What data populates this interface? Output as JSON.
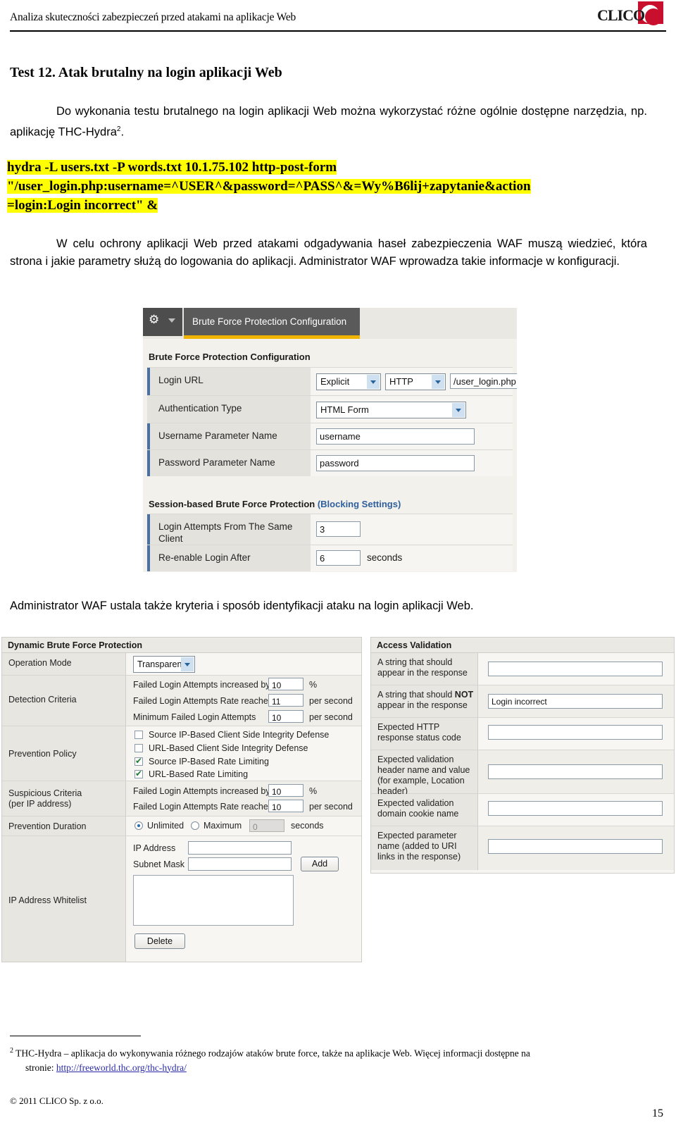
{
  "header": {
    "title": "Analiza skuteczności zabezpieczeń przed atakami na aplikacje Web",
    "logo_text": "CLICO",
    "logo_accent": "#c8102e"
  },
  "doc": {
    "title": "Test 12. Atak brutalny na login aplikacji Web",
    "intro": "Do wykonania testu brutalnego na login aplikacji Web można wykorzystać różne ogólnie dostępne narzędzia, np. aplikację THC-Hydra",
    "intro_footnote_marker": "2",
    "intro_tail": ".",
    "command_lines": [
      "hydra -L users.txt -P words.txt 10.1.75.102  http-post-form",
      "\"/user_login.php:username=^USER^&password=^PASS^&=Wy%B6lij+zapytanie&action",
      "=login:Login incorrect\" &"
    ],
    "highlight_color": "#ffff00",
    "paragraph_waf": "W celu ochrony aplikacji Web przed atakami odgadywania haseł zabezpieczenia WAF muszą wiedzieć, która strona i jakie parametry służą do logowania do aplikacji. Administrator WAF wprowadza takie informacje w konfiguracji.",
    "paragraph_mid": "Administrator WAF ustala także kryteria i sposób identyfikacji ataku na login aplikacji Web."
  },
  "shot1": {
    "gear_icon": "gear-icon",
    "tab_label": "Brute Force Protection Configuration",
    "tab_accent": "#f0b400",
    "section_title": "Brute Force Protection Configuration",
    "rows": [
      {
        "label": "Login URL",
        "select1": "Explicit",
        "select2": "HTTP",
        "input": "/user_login.php"
      },
      {
        "label": "Authentication Type",
        "select1": "HTML Form"
      },
      {
        "label": "Username Parameter Name",
        "input": "username"
      },
      {
        "label": "Password Parameter Name",
        "input": "password"
      }
    ],
    "session_section_title": "Session-based Brute Force Protection ",
    "session_section_link": "(Blocking Settings)",
    "session_rows": [
      {
        "label": "Login Attempts From The Same Client",
        "input": "3",
        "suffix": ""
      },
      {
        "label": "Re-enable Login After",
        "input": "6",
        "suffix": "seconds"
      }
    ]
  },
  "shot2_left": {
    "panel_title": "Dynamic Brute Force Protection",
    "operation_mode_label": "Operation Mode",
    "operation_mode_value": "Transparent",
    "detection_criteria_label": "Detection Criteria",
    "detection_criteria": [
      {
        "text": "Failed Login Attempts increased by",
        "value": "10",
        "unit": "%"
      },
      {
        "text": "Failed Login Attempts Rate reached",
        "value": "11",
        "unit": "per second"
      },
      {
        "text": "Minimum Failed Login Attempts",
        "value": "10",
        "unit": "per second"
      }
    ],
    "prevention_policy_label": "Prevention Policy",
    "prevention_policy": [
      {
        "label": "Source IP-Based Client Side Integrity Defense",
        "checked": false
      },
      {
        "label": "URL-Based Client Side Integrity Defense",
        "checked": false
      },
      {
        "label": "Source IP-Based Rate Limiting",
        "checked": true
      },
      {
        "label": "URL-Based Rate Limiting",
        "checked": true
      }
    ],
    "suspicious_label_line1": "Suspicious Criteria",
    "suspicious_label_line2": "(per IP address)",
    "suspicious_criteria": [
      {
        "text": "Failed Login Attempts increased by",
        "value": "10",
        "unit": "%"
      },
      {
        "text": "Failed Login Attempts Rate reached",
        "value": "10",
        "unit": "per second"
      }
    ],
    "prevention_duration_label": "Prevention Duration",
    "duration_unlimited": "Unlimited",
    "duration_maximum": "Maximum",
    "duration_value": "0",
    "duration_unit": "seconds",
    "duration_selected": "Unlimited",
    "whitelist_label": "IP Address Whitelist",
    "ip_address_label": "IP Address",
    "ip_address_value": "",
    "subnet_mask_label": "Subnet Mask",
    "subnet_mask_value": "",
    "add_button": "Add",
    "delete_button": "Delete",
    "whitelist_items": []
  },
  "shot2_right": {
    "panel_title": "Access Validation",
    "rows": [
      {
        "label": "A string that should appear in the response",
        "value": ""
      },
      {
        "label_pre": "A string that should ",
        "label_bold": "NOT",
        "label_post": " appear in the response",
        "value": "Login incorrect"
      },
      {
        "label": "Expected HTTP response status code",
        "value": ""
      },
      {
        "label": "Expected validation header name and value (for example, Location header)",
        "value": ""
      },
      {
        "label": "Expected validation domain cookie name",
        "value": ""
      },
      {
        "label": "Expected parameter name (added to URI links in the response)",
        "value": ""
      }
    ]
  },
  "footer": {
    "footnote_marker": "2",
    "footnote_text": "THC-Hydra – aplikacja do wykonywania różnego rodzajów ataków brute force, także na aplikacje Web. Więcej informacji dostępne na",
    "footnote_text2": "stronie: ",
    "footnote_url": "http://freeworld.thc.org/thc-hydra/",
    "copyright": "© 2011 CLICO Sp. z o.o.",
    "page_number": "15"
  }
}
